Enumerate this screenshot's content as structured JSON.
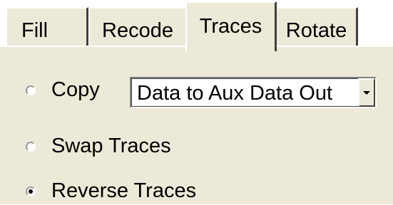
{
  "tabs": [
    {
      "label": "Fill",
      "active": false
    },
    {
      "label": "Recode",
      "active": false
    },
    {
      "label": "Traces",
      "active": true
    },
    {
      "label": "Rotate",
      "active": false
    }
  ],
  "options": {
    "copy": {
      "label": "Copy",
      "checked": false
    },
    "swap": {
      "label": "Swap Traces",
      "checked": false
    },
    "reverse": {
      "label": "Reverse Traces",
      "checked": true
    }
  },
  "copy_target": {
    "selected": "Data to Aux Data Out",
    "icon": "chevron-down-icon"
  },
  "colors": {
    "face": "#ece9d8",
    "highlight": "#ffffff",
    "shadow": "#404040"
  }
}
